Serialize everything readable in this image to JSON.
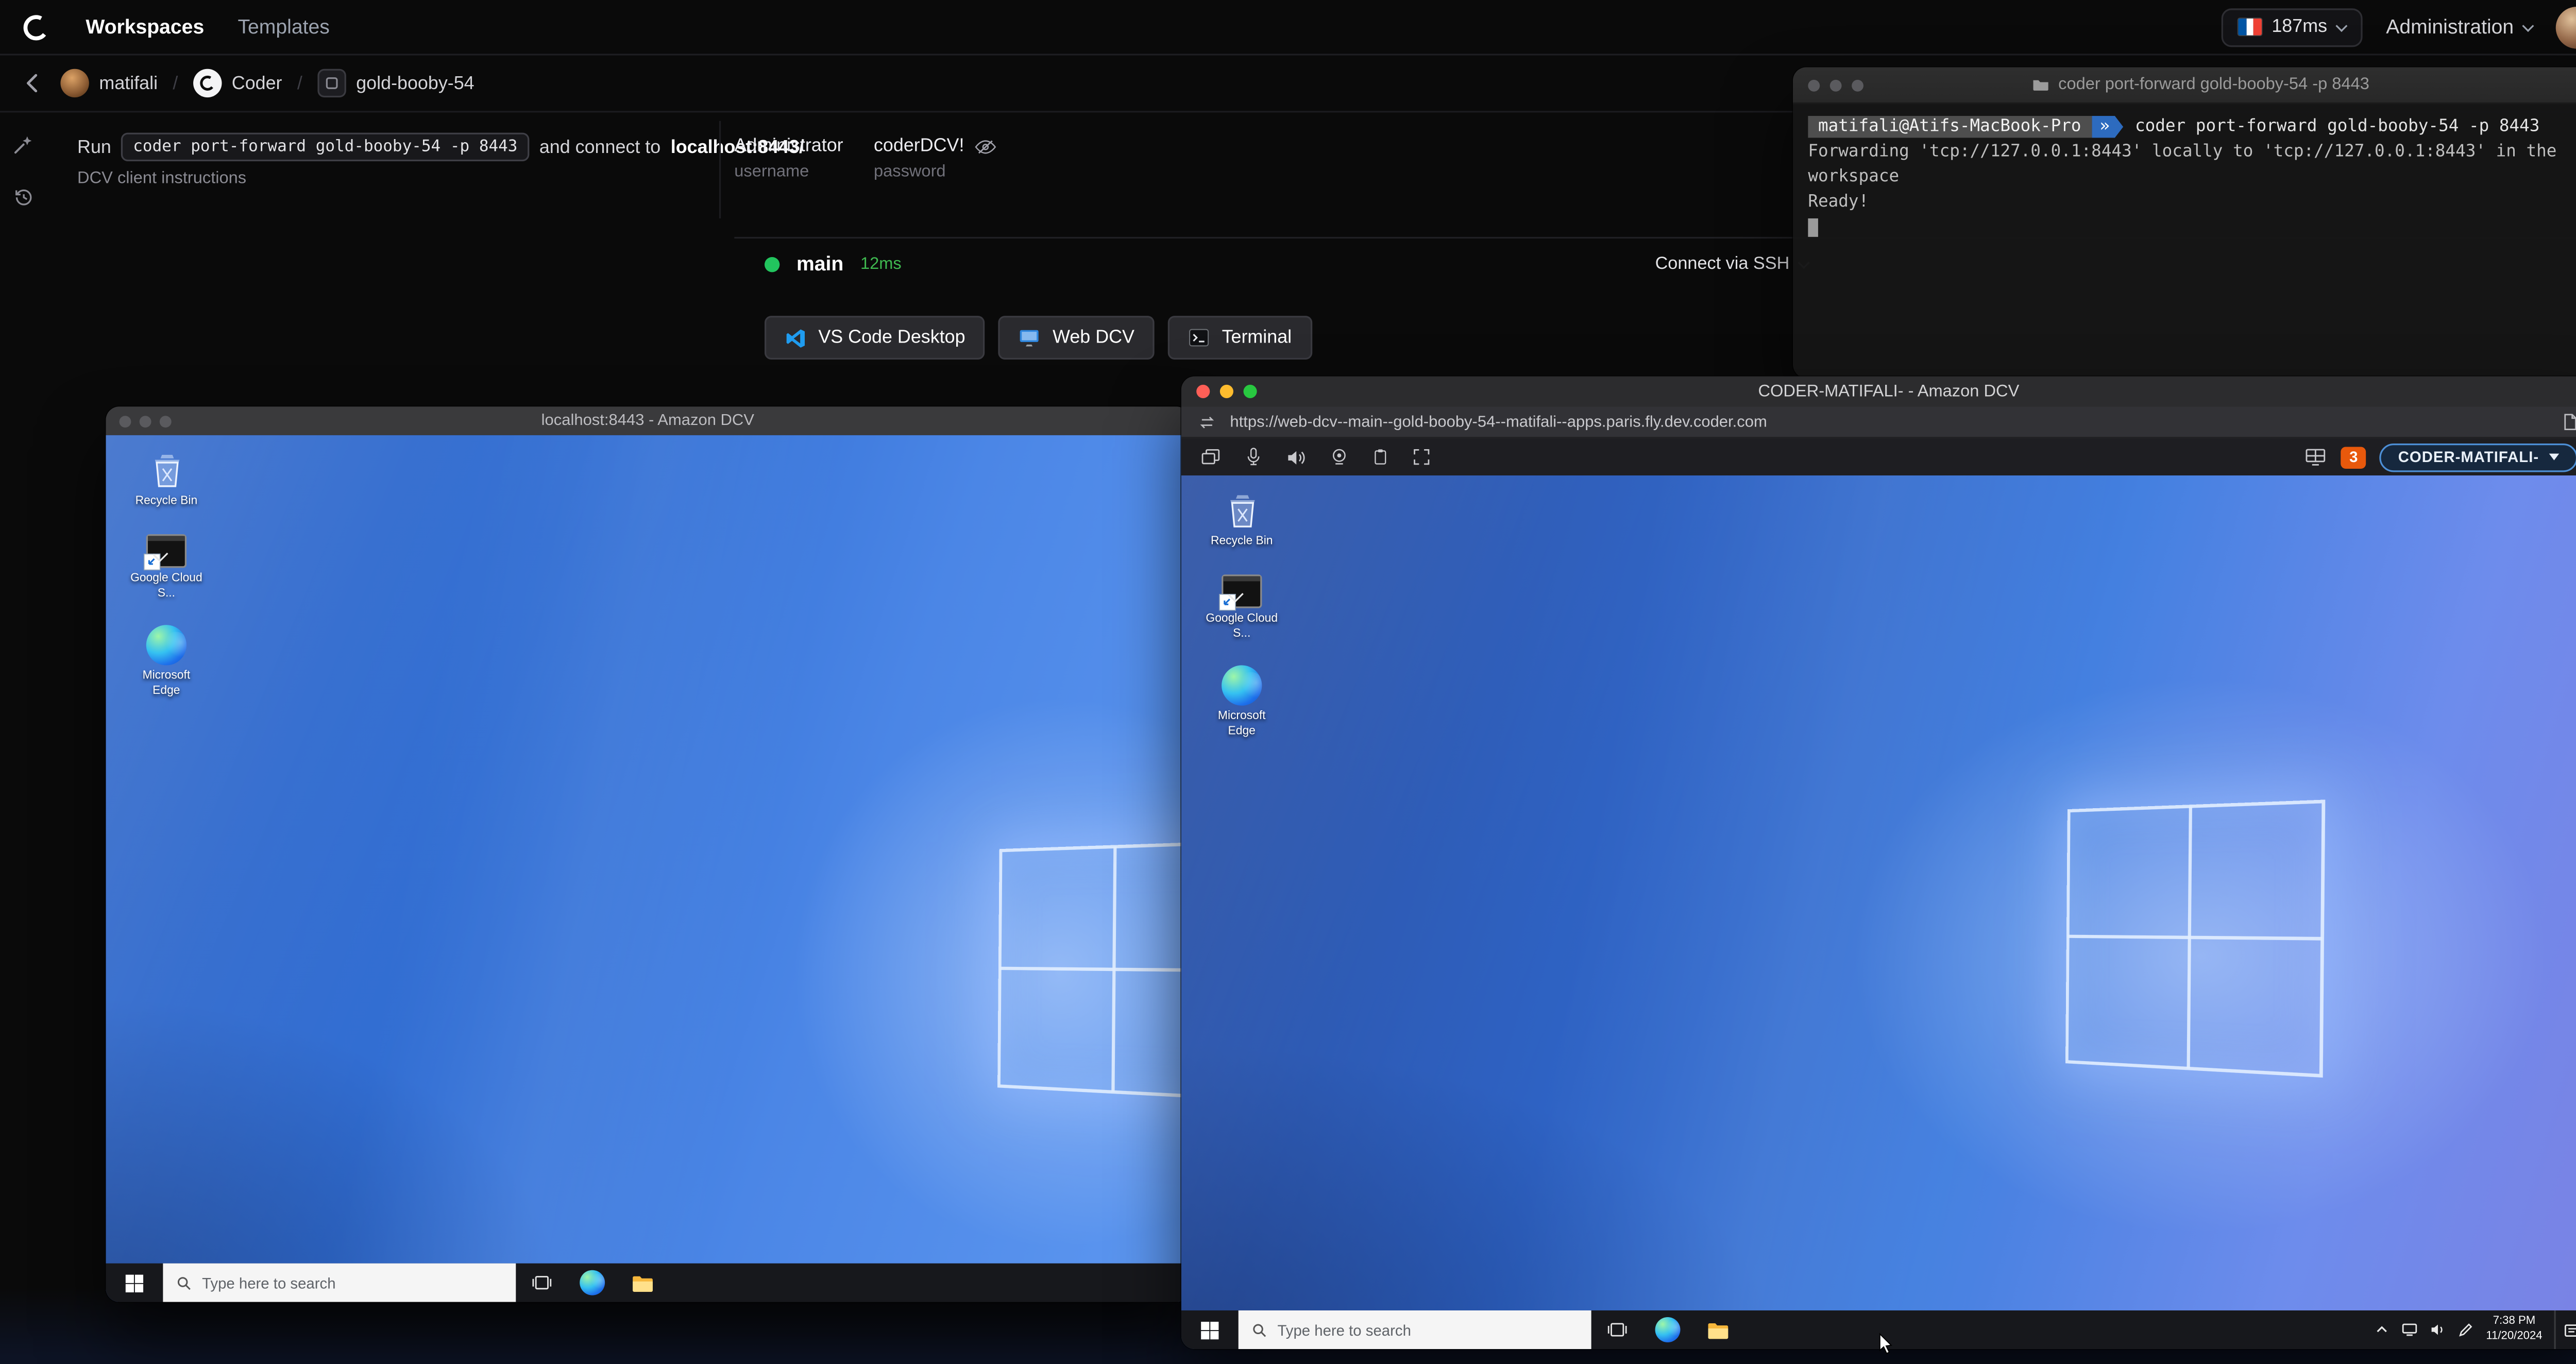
{
  "topnav": {
    "workspaces": "Workspaces",
    "templates": "Templates",
    "latency": "187ms",
    "administration": "Administration"
  },
  "breadcrumb": {
    "separator": "/",
    "user": "matifali",
    "template": "Coder",
    "workspace": "gold-booby-54"
  },
  "panel": {
    "run": "Run",
    "command": "coder port-forward gold-booby-54 -p 8443",
    "and_connect": "and connect to",
    "target": "localhost:8443/",
    "dcv_link": "DCV client instructions",
    "username_value": "Administrator",
    "username_label": "username",
    "password_value": "coderDCV!",
    "password_label": "password"
  },
  "agent": {
    "name": "main",
    "latency": "12ms",
    "connect_ssh": "Connect via SSH",
    "btn_vscode": "VS Code Desktop",
    "btn_webdcv": "Web DCV",
    "btn_terminal": "Terminal"
  },
  "terminal": {
    "title": "coder port-forward gold-booby-54 -p 8443",
    "prompt_host": "matifali@Atifs-MacBook-Pro",
    "prompt_arrow": "»",
    "command": "coder port-forward gold-booby-54 -p 8443",
    "output_1": "Forwarding 'tcp://127.0.0.1:8443' locally to 'tcp://127.0.0.1:8443' in the workspace",
    "output_2": "Ready!"
  },
  "back_window": {
    "title": "localhost:8443 - Amazon DCV",
    "icon_recycle": "Recycle Bin",
    "icon_cloud": "Google Cloud S...",
    "icon_edge": "Microsoft Edge",
    "search_placeholder": "Type here to search"
  },
  "front_window": {
    "title": "CODER-MATIFALI- - Amazon DCV",
    "url": "https://web-dcv--main--gold-booby-54--matifali--apps.paris.fly.dev.coder.com",
    "notifications": "3",
    "session": "CODER-MATIFALI-",
    "icon_recycle": "Recycle Bin",
    "icon_cloud": "Google Cloud S...",
    "icon_edge": "Microsoft Edge",
    "search_placeholder": "Type here to search",
    "time": "7:38 PM",
    "date": "11/20/2024"
  }
}
